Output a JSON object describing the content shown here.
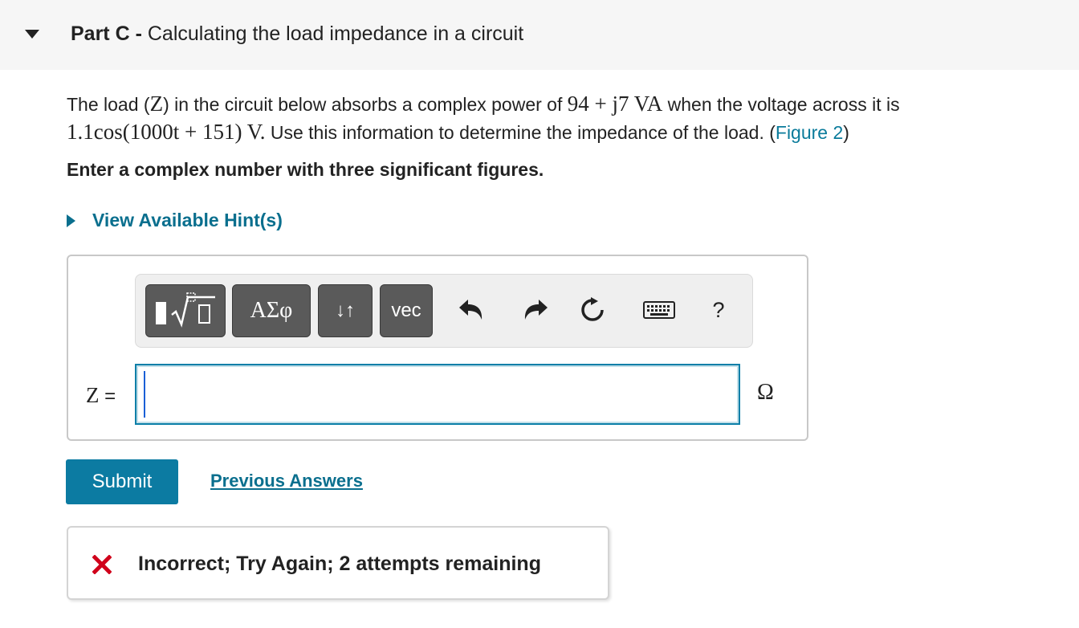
{
  "part": {
    "label": "Part C -",
    "title": "Calculating the load impedance in a circuit"
  },
  "problem": {
    "text1": "The load (",
    "load_var": "Z",
    "text2": ") in the circuit below absorbs a complex power of ",
    "power_expr": "94 + j7 VA",
    "text3": " when the voltage across it is",
    "voltage_expr": "1.1cos(1000t + 151) V.",
    "text4": " Use this information to determine the impedance of the load. (",
    "figure_link": "Figure 2",
    "text5": ")"
  },
  "instruction": "Enter a complex number with three significant figures.",
  "hint": {
    "label": "View Available Hint(s)"
  },
  "toolbar": {
    "greek_label": "ΑΣφ",
    "arrows_label": "↓↑",
    "vec_label": "vec",
    "help_label": "?",
    "icons": [
      "templates-icon",
      "undo-icon",
      "redo-icon",
      "reset-icon",
      "keyboard-icon",
      "help-icon"
    ]
  },
  "answer": {
    "variable": "Z",
    "equals": " =",
    "value": "",
    "unit": "Ω"
  },
  "actions": {
    "submit_label": "Submit",
    "previous_answers_label": "Previous Answers"
  },
  "feedback": {
    "status": "incorrect",
    "message": "Incorrect; Try Again; 2 attempts remaining",
    "color": "#d0021b"
  },
  "colors": {
    "accent": "#0c7ba2",
    "link": "#0a6f8e",
    "header_bg": "#f6f6f6"
  }
}
